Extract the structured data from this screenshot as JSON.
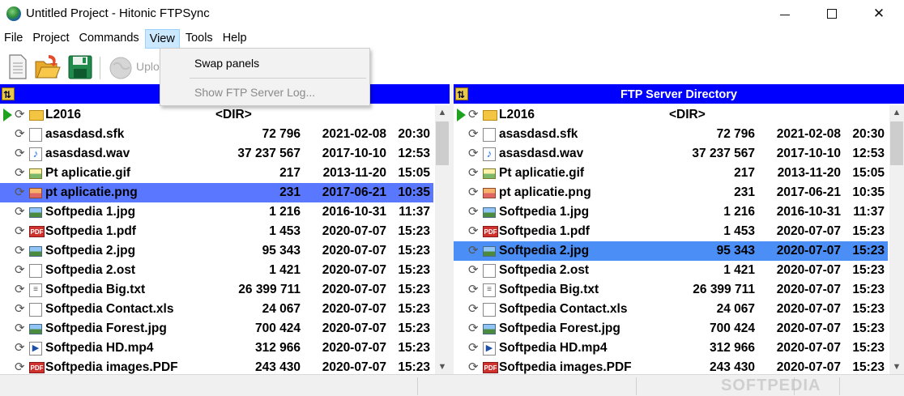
{
  "window": {
    "title": "Untitled Project - Hitonic FTPSync"
  },
  "menu": {
    "items": [
      "File",
      "Project",
      "Commands",
      "View",
      "Tools",
      "Help"
    ],
    "active": "View"
  },
  "toolbar": {
    "upload_label": "Uplo"
  },
  "view_menu": {
    "swap_panels": "Swap panels",
    "show_log": "Show FTP Server Log..."
  },
  "left_panel": {
    "title": "",
    "rows": [
      {
        "name": "L2016",
        "dir": "<DIR>",
        "icon": "folder-icon",
        "kind": "folder"
      },
      {
        "name": "asasdasd.sfk",
        "size": "72 796",
        "date": "2021-02-08",
        "time": "20:30",
        "icon": "file-icon",
        "kind": "blank"
      },
      {
        "name": "asasdasd.wav",
        "size": "37 237 567",
        "date": "2017-10-10",
        "time": "12:53",
        "icon": "audio-file-icon",
        "kind": "audio"
      },
      {
        "name": "Pt aplicatie.gif",
        "size": "217",
        "date": "2013-11-20",
        "time": "15:05",
        "icon": "gif-image-icon",
        "kind": "gif"
      },
      {
        "name": "pt aplicatie.png",
        "size": "231",
        "date": "2017-06-21",
        "time": "10:35",
        "icon": "png-image-icon",
        "kind": "png",
        "selected": true
      },
      {
        "name": "Softpedia 1.jpg",
        "size": "1 216",
        "date": "2016-10-31",
        "time": "11:37",
        "icon": "jpg-image-icon",
        "kind": "image"
      },
      {
        "name": "Softpedia 1.pdf",
        "size": "1 453",
        "date": "2020-07-07",
        "time": "15:23",
        "icon": "pdf-icon",
        "kind": "pdf"
      },
      {
        "name": "Softpedia 2.jpg",
        "size": "95 343",
        "date": "2020-07-07",
        "time": "15:23",
        "icon": "jpg-image-icon",
        "kind": "image"
      },
      {
        "name": "Softpedia 2.ost",
        "size": "1 421",
        "date": "2020-07-07",
        "time": "15:23",
        "icon": "file-icon",
        "kind": "blank"
      },
      {
        "name": "Softpedia Big.txt",
        "size": "26 399 711",
        "date": "2020-07-07",
        "time": "15:23",
        "icon": "text-file-icon",
        "kind": "text"
      },
      {
        "name": "Softpedia Contact.xls",
        "size": "24 067",
        "date": "2020-07-07",
        "time": "15:23",
        "icon": "file-icon",
        "kind": "blank"
      },
      {
        "name": "Softpedia Forest.jpg",
        "size": "700 424",
        "date": "2020-07-07",
        "time": "15:23",
        "icon": "jpg-image-icon",
        "kind": "image"
      },
      {
        "name": "Softpedia HD.mp4",
        "size": "312 966",
        "date": "2020-07-07",
        "time": "15:23",
        "icon": "video-file-icon",
        "kind": "video"
      },
      {
        "name": "Softpedia images.PDF",
        "size": "243 430",
        "date": "2020-07-07",
        "time": "15:23",
        "icon": "pdf-icon",
        "kind": "pdf"
      }
    ]
  },
  "right_panel": {
    "title": "FTP Server Directory",
    "rows": [
      {
        "name": "L2016",
        "dir": "<DIR>",
        "icon": "folder-icon",
        "kind": "folder"
      },
      {
        "name": "asasdasd.sfk",
        "size": "72 796",
        "date": "2021-02-08",
        "time": "20:30",
        "icon": "file-icon",
        "kind": "blank"
      },
      {
        "name": "asasdasd.wav",
        "size": "37 237 567",
        "date": "2017-10-10",
        "time": "12:53",
        "icon": "audio-file-icon",
        "kind": "audio"
      },
      {
        "name": "Pt aplicatie.gif",
        "size": "217",
        "date": "2013-11-20",
        "time": "15:05",
        "icon": "gif-image-icon",
        "kind": "gif"
      },
      {
        "name": "pt aplicatie.png",
        "size": "231",
        "date": "2017-06-21",
        "time": "10:35",
        "icon": "png-image-icon",
        "kind": "png"
      },
      {
        "name": "Softpedia 1.jpg",
        "size": "1 216",
        "date": "2016-10-31",
        "time": "11:37",
        "icon": "jpg-image-icon",
        "kind": "image"
      },
      {
        "name": "Softpedia 1.pdf",
        "size": "1 453",
        "date": "2020-07-07",
        "time": "15:23",
        "icon": "pdf-icon",
        "kind": "pdf"
      },
      {
        "name": "Softpedia 2.jpg",
        "size": "95 343",
        "date": "2020-07-07",
        "time": "15:23",
        "icon": "jpg-image-icon",
        "kind": "image",
        "selected": true
      },
      {
        "name": "Softpedia 2.ost",
        "size": "1 421",
        "date": "2020-07-07",
        "time": "15:23",
        "icon": "file-icon",
        "kind": "blank"
      },
      {
        "name": "Softpedia Big.txt",
        "size": "26 399 711",
        "date": "2020-07-07",
        "time": "15:23",
        "icon": "text-file-icon",
        "kind": "text"
      },
      {
        "name": "Softpedia Contact.xls",
        "size": "24 067",
        "date": "2020-07-07",
        "time": "15:23",
        "icon": "file-icon",
        "kind": "blank"
      },
      {
        "name": "Softpedia Forest.jpg",
        "size": "700 424",
        "date": "2020-07-07",
        "time": "15:23",
        "icon": "jpg-image-icon",
        "kind": "image"
      },
      {
        "name": "Softpedia HD.mp4",
        "size": "312 966",
        "date": "2020-07-07",
        "time": "15:23",
        "icon": "video-file-icon",
        "kind": "video"
      },
      {
        "name": "Softpedia images.PDF",
        "size": "243 430",
        "date": "2020-07-07",
        "time": "15:23",
        "icon": "pdf-icon",
        "kind": "pdf"
      }
    ]
  },
  "colors": {
    "panel_header": "#0000ff",
    "selection_left": "#5a78ff",
    "selection_right": "#4b8ef5",
    "menu_active": "#cce8ff"
  },
  "watermark": "SOFTPEDIA"
}
